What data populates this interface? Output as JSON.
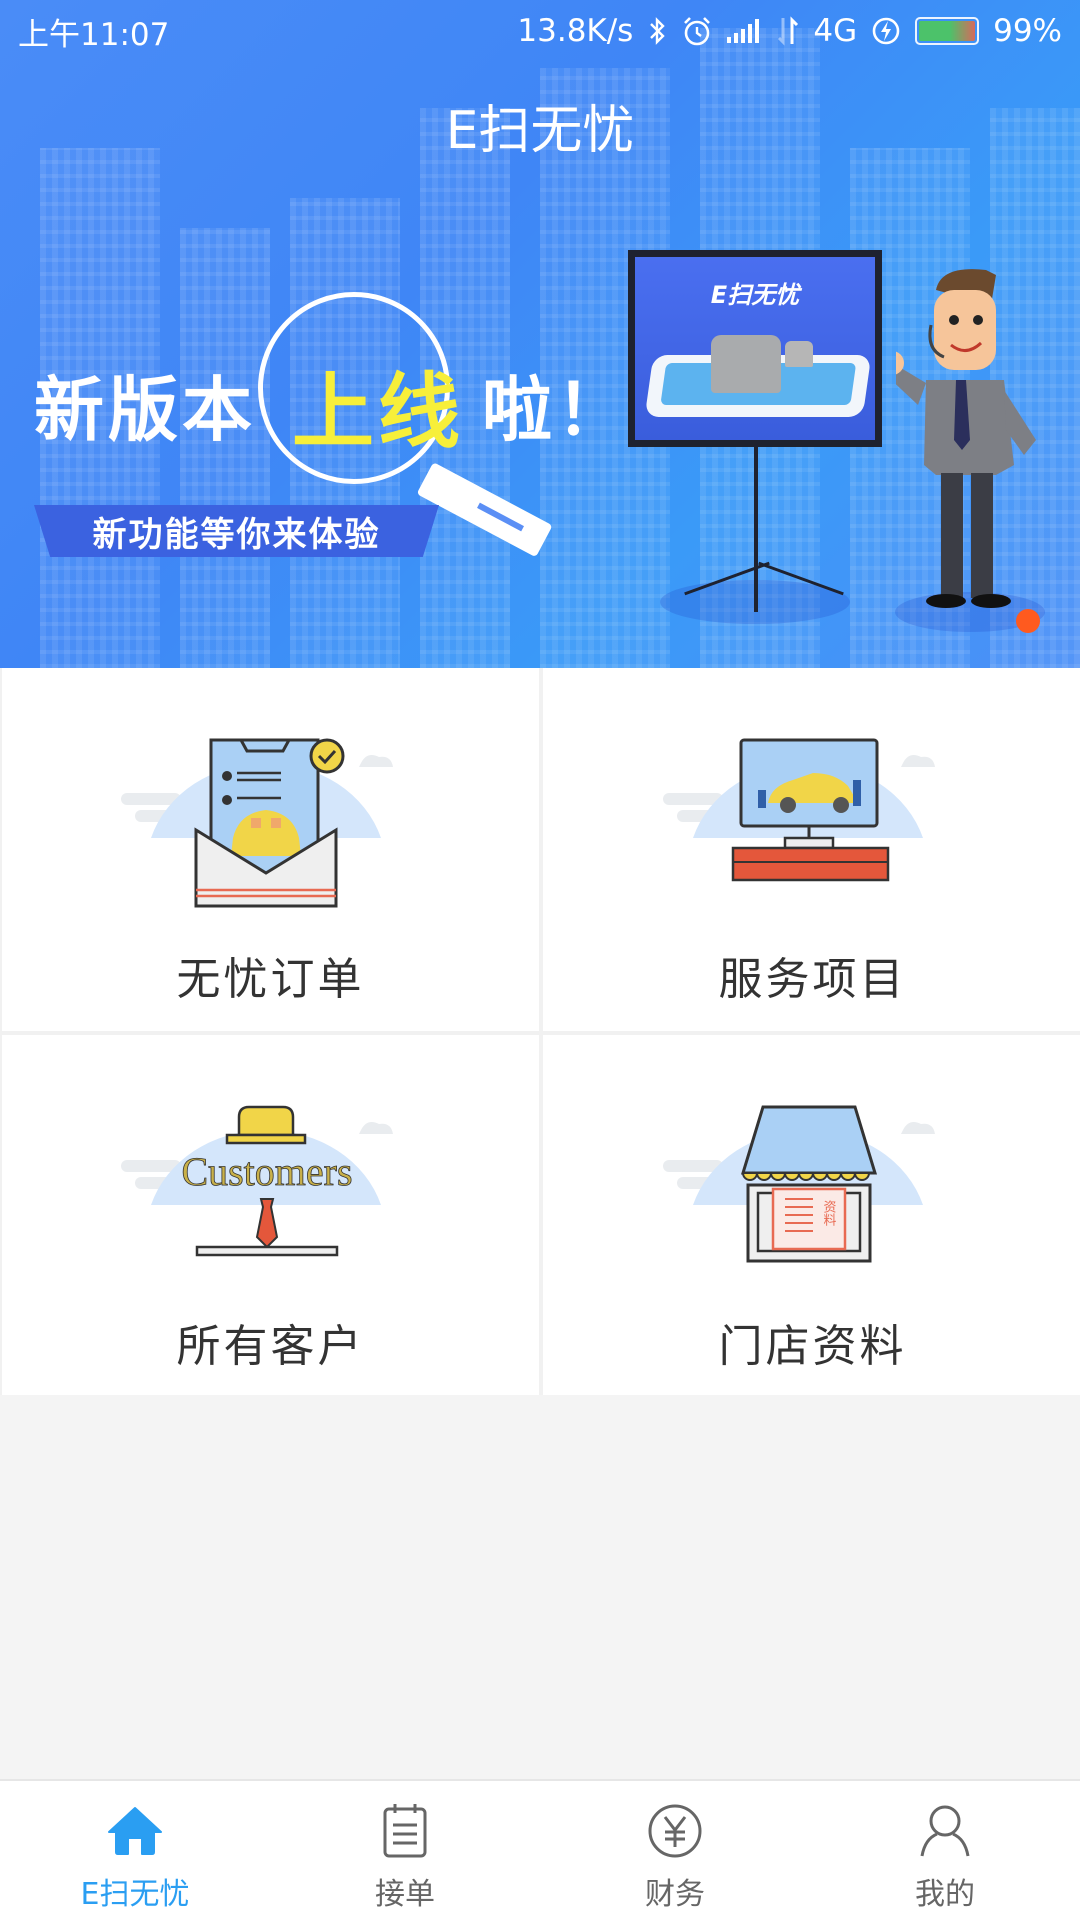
{
  "status_bar": {
    "time": "上午11:07",
    "network_speed": "13.8K/s",
    "network_type": "4G",
    "battery_percent": "99%",
    "battery_level": 0.99,
    "icons": [
      "bluetooth-icon",
      "alarm-icon",
      "signal-icon",
      "data-arrows-icon",
      "charging-icon",
      "battery-icon"
    ]
  },
  "header": {
    "title": "E扫无忧"
  },
  "banner": {
    "headline_prefix": "新版本",
    "headline_highlight": "上线",
    "headline_suffix": "啦！",
    "ribbon_text": "新功能等你来体验",
    "board_title": "E扫无忧",
    "carousel_index": 1,
    "carousel_count": 1,
    "colors": {
      "highlight": "#f7ef3a",
      "indicator": "#ff5a1f"
    }
  },
  "menu": {
    "items": [
      {
        "label": "无忧订单",
        "icon": "order-envelope-icon"
      },
      {
        "label": "服务项目",
        "icon": "service-monitor-icon"
      },
      {
        "label": "所有客户",
        "icon": "customers-icon",
        "art_text": "Customers"
      },
      {
        "label": "门店资料",
        "icon": "store-info-icon",
        "art_text": "资料"
      }
    ]
  },
  "tabbar": {
    "active_color": "#2a9ef2",
    "inactive_color": "#666666",
    "tabs": [
      {
        "label": "E扫无忧",
        "icon": "home-icon",
        "active": true
      },
      {
        "label": "接单",
        "icon": "clipboard-icon",
        "active": false
      },
      {
        "label": "财务",
        "icon": "yuan-icon",
        "active": false
      },
      {
        "label": "我的",
        "icon": "user-icon",
        "active": false
      }
    ]
  }
}
